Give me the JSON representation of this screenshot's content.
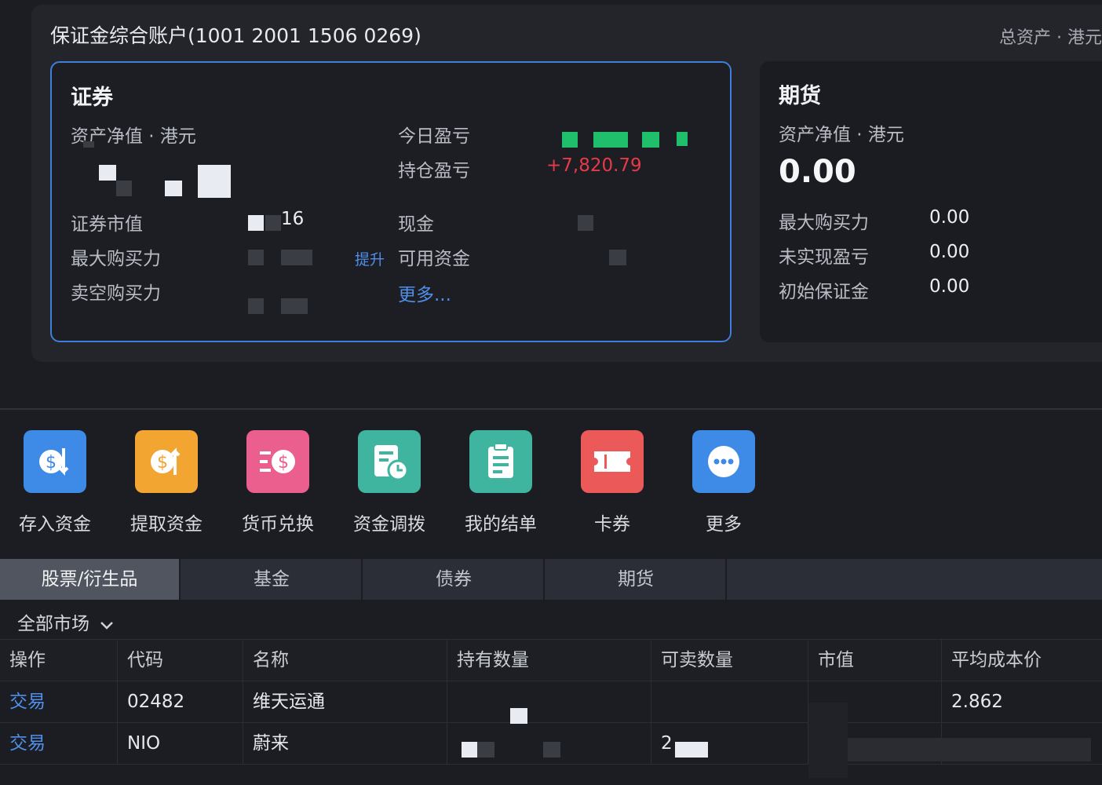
{
  "account": {
    "title": "保证金综合账户(1001 2001 1506 0269)",
    "total_assets_label": "总资产 · 港元"
  },
  "securities": {
    "title": "证券",
    "net_asset_label": "资产净值 · 港元",
    "today_pnl_label": "今日盈亏",
    "position_pnl_label": "持仓盈亏",
    "position_pnl_value": "+7,820.79",
    "market_value_label": "证券市值",
    "market_value_partial": "16",
    "cash_label": "现金",
    "max_buy_label": "最大购买力",
    "upgrade_link": "提升",
    "available_label": "可用资金",
    "short_buy_label": "卖空购买力",
    "more_link": "更多..."
  },
  "futures": {
    "title": "期货",
    "net_asset_label": "资产净值 · 港元",
    "net_asset_value": "0.00",
    "rows": [
      {
        "label": "最大购买力",
        "value": "0.00"
      },
      {
        "label": "未实现盈亏",
        "value": "0.00"
      },
      {
        "label": "初始保证金",
        "value": "0.00"
      }
    ]
  },
  "toolbar": {
    "items": [
      {
        "label": "存入资金",
        "icon": "deposit-icon",
        "color": "#3d8be6"
      },
      {
        "label": "提取资金",
        "icon": "withdraw-icon",
        "color": "#f3a532"
      },
      {
        "label": "货币兑换",
        "icon": "currency-exchange-icon",
        "color": "#ea5f8d"
      },
      {
        "label": "资金调拨",
        "icon": "fund-transfer-icon",
        "color": "#3fb5a0"
      },
      {
        "label": "我的结单",
        "icon": "statement-icon",
        "color": "#3fb5a0"
      },
      {
        "label": "卡券",
        "icon": "coupon-icon",
        "color": "#ec5959"
      },
      {
        "label": "更多",
        "icon": "more-icon",
        "color": "#3d8be6"
      }
    ]
  },
  "tabs": [
    "股票/衍生品",
    "基金",
    "债券",
    "期货"
  ],
  "market_filter": "全部市场",
  "table": {
    "headers": [
      "操作",
      "代码",
      "名称",
      "持有数量",
      "可卖数量",
      "市值",
      "平均成本价"
    ],
    "rows": [
      {
        "action": "交易",
        "code": "02482",
        "name": "维天运通",
        "avg_cost": "2.862"
      },
      {
        "action": "交易",
        "code": "NIO",
        "name": "蔚来",
        "sellable_partial": "2"
      }
    ]
  }
}
